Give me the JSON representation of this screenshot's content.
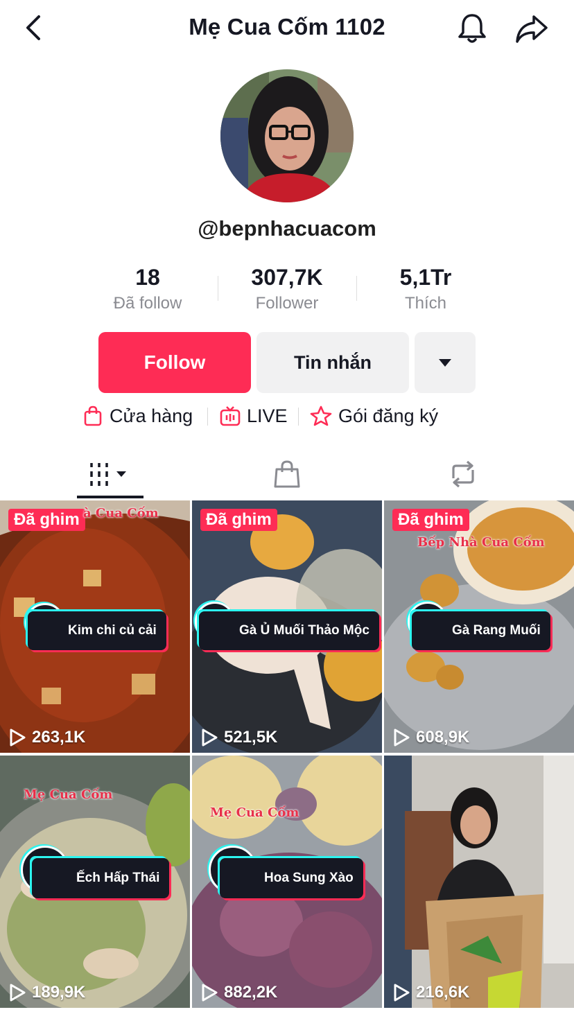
{
  "header": {
    "title": "Mẹ Cua Cốm 1102"
  },
  "profile": {
    "handle": "@bepnhacuacom"
  },
  "stats": [
    {
      "value": "18",
      "label": "Đã follow"
    },
    {
      "value": "307,7K",
      "label": "Follower"
    },
    {
      "value": "5,1Tr",
      "label": "Thích"
    }
  ],
  "actions": {
    "follow": "Follow",
    "message": "Tin nhắn"
  },
  "links": [
    {
      "label": "Cửa hàng",
      "icon": "shopping-bag-icon"
    },
    {
      "label": "LIVE",
      "icon": "live-tv-icon"
    },
    {
      "label": "Gói đăng ký",
      "icon": "subscription-star-icon"
    }
  ],
  "tabs": [
    {
      "icon": "videos-grid-icon",
      "active": true
    },
    {
      "icon": "shop-bag-icon",
      "active": false
    },
    {
      "icon": "repost-icon",
      "active": false
    }
  ],
  "videos": [
    {
      "pinned": "Đã ghim",
      "watermark": "à Cua Cốm",
      "caption": "Kim chi củ cải",
      "views": "263,1K"
    },
    {
      "pinned": "Đã ghim",
      "watermark": "",
      "caption": "Gà Ủ Muối Thảo Mộc",
      "views": "521,5K"
    },
    {
      "pinned": "Đã ghim",
      "watermark": "Bếp Nhà Cua Cốm",
      "caption": "Gà Rang Muối",
      "views": "608,9K"
    },
    {
      "pinned": "",
      "watermark": "Mẹ Cua Cốm",
      "caption": "Ếch Hấp Thái",
      "views": "189,9K"
    },
    {
      "pinned": "",
      "watermark": "Mẹ Cua Cốm",
      "caption": "Hoa Sung Xào",
      "views": "882,2K"
    },
    {
      "pinned": "",
      "watermark": "",
      "caption": "",
      "views": "216,6K"
    }
  ],
  "colors": {
    "accent": "#fe2c55",
    "cyan": "#2cf4ef",
    "text": "#161823",
    "muted": "#8a8b91"
  }
}
